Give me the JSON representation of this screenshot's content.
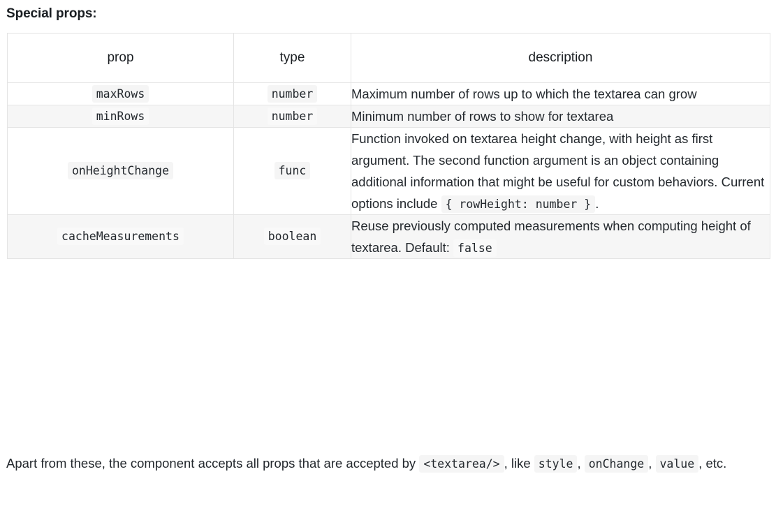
{
  "heading": "Special props:",
  "table": {
    "columns": [
      "prop",
      "type",
      "description"
    ],
    "rows": [
      {
        "prop": "maxRows",
        "type": "number",
        "description_parts": [
          {
            "kind": "text",
            "text": "Maximum number of rows up to which the textarea can grow"
          }
        ]
      },
      {
        "prop": "minRows",
        "type": "number",
        "description_parts": [
          {
            "kind": "text",
            "text": "Minimum number of rows to show for textarea"
          }
        ]
      },
      {
        "prop": "onHeightChange",
        "type": "func",
        "description_parts": [
          {
            "kind": "text",
            "text": "Function invoked on textarea height change, with height as first argument. The second function argument is an object containing additional information that might be useful for custom behaviors. Current options include "
          },
          {
            "kind": "code",
            "text": "{ rowHeight: number }"
          },
          {
            "kind": "text",
            "text": "."
          }
        ]
      },
      {
        "prop": "cacheMeasurements",
        "type": "boolean",
        "description_parts": [
          {
            "kind": "text",
            "text": "Reuse previously computed measurements when computing height of textarea. Default: "
          },
          {
            "kind": "code",
            "text": "false"
          }
        ]
      }
    ]
  },
  "footnote_parts": [
    {
      "kind": "text",
      "text": "Apart from these, the component accepts all props that are accepted by "
    },
    {
      "kind": "code",
      "text": "<textarea/>"
    },
    {
      "kind": "text",
      "text": ", like "
    },
    {
      "kind": "code",
      "text": "style"
    },
    {
      "kind": "text",
      "text": ", "
    },
    {
      "kind": "code",
      "text": "onChange"
    },
    {
      "kind": "text",
      "text": ", "
    },
    {
      "kind": "code",
      "text": "value"
    },
    {
      "kind": "text",
      "text": ", etc."
    }
  ],
  "colors": {
    "text": "#24292e",
    "border": "#e4e4e4",
    "zebra": "#f6f6f6",
    "code_bg": "#f5f5f5",
    "page_bg": "#ffffff"
  }
}
